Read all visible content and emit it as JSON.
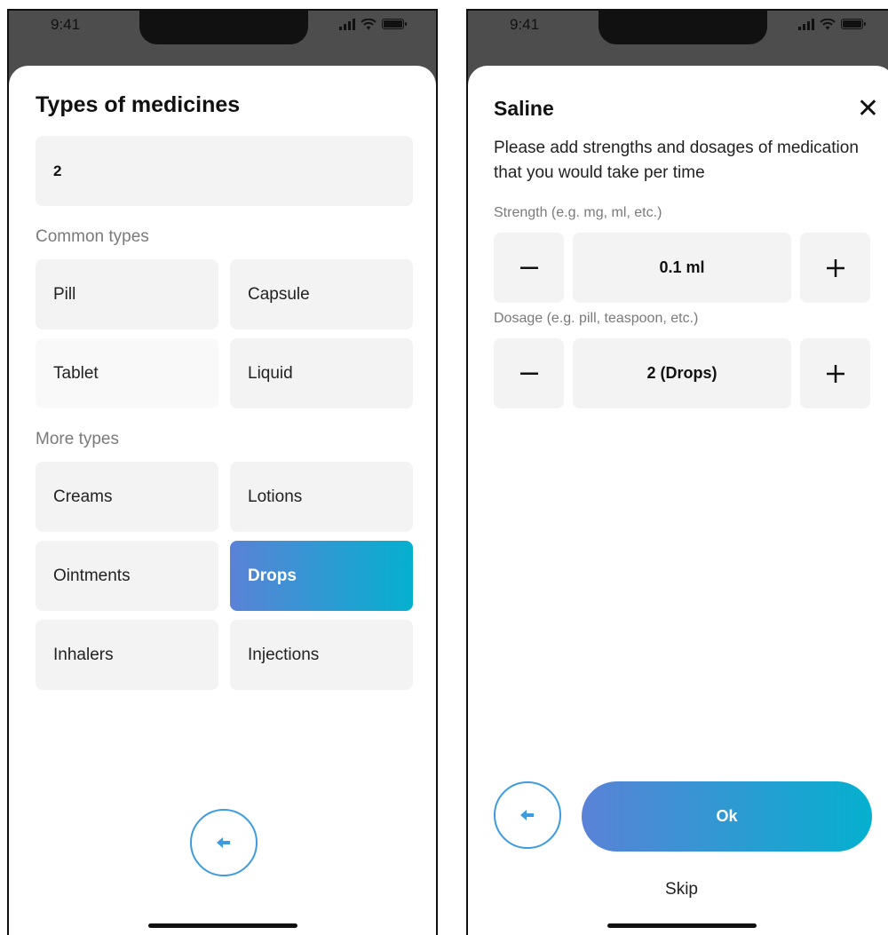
{
  "status_bar": {
    "time": "9:41"
  },
  "screen1": {
    "title": "Types of medicines",
    "input_value": "2",
    "common_label": "Common types",
    "common_types": [
      "Pill",
      "Capsule",
      "Tablet",
      "Liquid"
    ],
    "more_label": "More types",
    "more_types": [
      "Creams",
      "Lotions",
      "Ointments",
      "Drops",
      "Inhalers",
      "Injections"
    ],
    "selected_type": "Drops"
  },
  "screen2": {
    "title": "Saline",
    "description": "Please add strengths and dosages of medication that you would take per time",
    "strength_label": "Strength (e.g. mg, ml, etc.)",
    "strength_value": "0.1 ml",
    "dosage_label": "Dosage (e.g. pill, teaspoon, etc.)",
    "dosage_value": "2 (Drops)",
    "ok_label": "Ok",
    "skip_label": "Skip"
  },
  "colors": {
    "accent_start": "#5a82d6",
    "accent_end": "#05b0cf",
    "tile_bg": "#f3f3f3",
    "back_icon": "#3d9be0"
  },
  "icons": [
    "signal-icon",
    "wifi-icon",
    "battery-icon",
    "back-arrow-icon",
    "close-icon",
    "minus-icon",
    "plus-icon"
  ]
}
